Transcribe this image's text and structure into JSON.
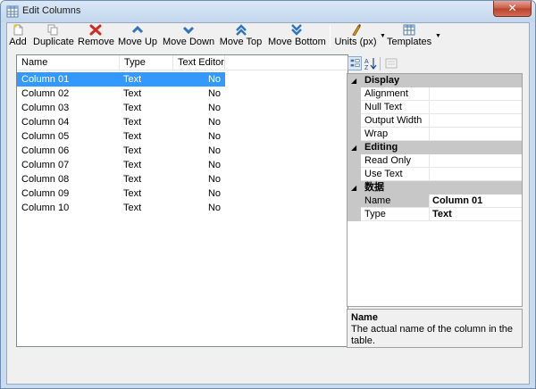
{
  "window": {
    "title": "Edit Columns",
    "close_label": "✕"
  },
  "toolbar": {
    "add": "Add",
    "duplicate": "Duplicate",
    "remove": "Remove",
    "move_up": "Move Up",
    "move_down": "Move Down",
    "move_top": "Move Top",
    "move_bottom": "Move Bottom",
    "units": "Units (px)",
    "templates": "Templates"
  },
  "list": {
    "headers": [
      "Name",
      "Type",
      "Text Editor"
    ],
    "rows": [
      [
        "Column 01",
        "Text",
        "No"
      ],
      [
        "Column 02",
        "Text",
        "No"
      ],
      [
        "Column 03",
        "Text",
        "No"
      ],
      [
        "Column 04",
        "Text",
        "No"
      ],
      [
        "Column 05",
        "Text",
        "No"
      ],
      [
        "Column 06",
        "Text",
        "No"
      ],
      [
        "Column 07",
        "Text",
        "No"
      ],
      [
        "Column 08",
        "Text",
        "No"
      ],
      [
        "Column 09",
        "Text",
        "No"
      ],
      [
        "Column 10",
        "Text",
        "No"
      ]
    ],
    "selected_index": 0
  },
  "properties": {
    "categories": [
      {
        "title": "Display",
        "props": [
          {
            "name": "Alignment",
            "value": ""
          },
          {
            "name": "Null Text",
            "value": ""
          },
          {
            "name": "Output Width",
            "value": ""
          },
          {
            "name": "Wrap",
            "value": ""
          }
        ]
      },
      {
        "title": "Editing",
        "props": [
          {
            "name": "Read Only",
            "value": ""
          },
          {
            "name": "Use Text Editor",
            "value": ""
          }
        ]
      },
      {
        "title": "数据",
        "props": [
          {
            "name": "Name",
            "value": "Column 01"
          },
          {
            "name": "Type",
            "value": "Text"
          }
        ]
      }
    ],
    "help_title": "Name",
    "help_desc": "The actual name of the column in the table."
  },
  "colors": {
    "selection": "#3399ff",
    "category_bg": "#c7c7c7",
    "window_frame": "#c9dbef"
  }
}
